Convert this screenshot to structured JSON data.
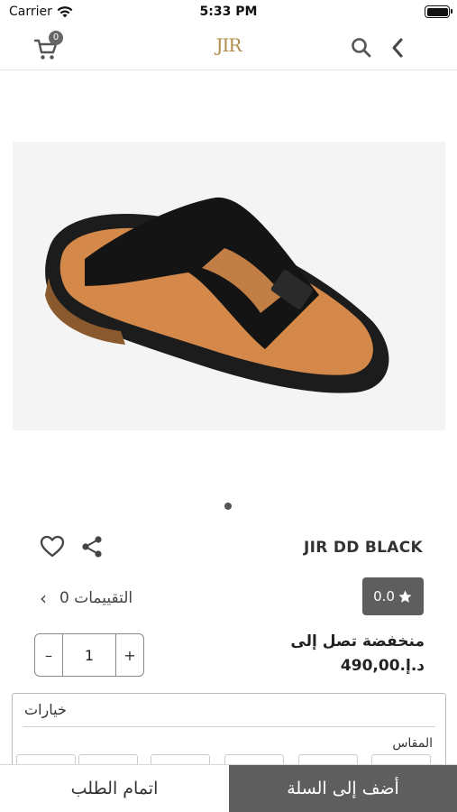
{
  "status_bar": {
    "carrier": "Carrier",
    "time": "5:33 PM"
  },
  "nav": {
    "cart_count": "0",
    "logo_text": "JIR"
  },
  "product": {
    "title": "JIR DD BLACK",
    "rating": "0.0",
    "reviews_label": "0 التقييمات",
    "price_label": "منخفضة تصل إلى",
    "price": "د.إ.490,00",
    "quantity": "1",
    "qty_minus": "–",
    "qty_plus": "+"
  },
  "options": {
    "title": "خيارات",
    "size_label": "المقاس"
  },
  "bottom_bar": {
    "checkout_label": "اتمام الطلب",
    "add_to_cart_label": "أضف إلى السلة"
  },
  "colors": {
    "accent_dark": "#5e5e5e",
    "logo_gold": "#b08d4a"
  },
  "icons": [
    "cart-icon",
    "search-icon",
    "back-chevron-icon",
    "heart-icon",
    "share-icon",
    "star-icon",
    "chevron-left-icon",
    "wifi-icon",
    "battery-icon"
  ]
}
